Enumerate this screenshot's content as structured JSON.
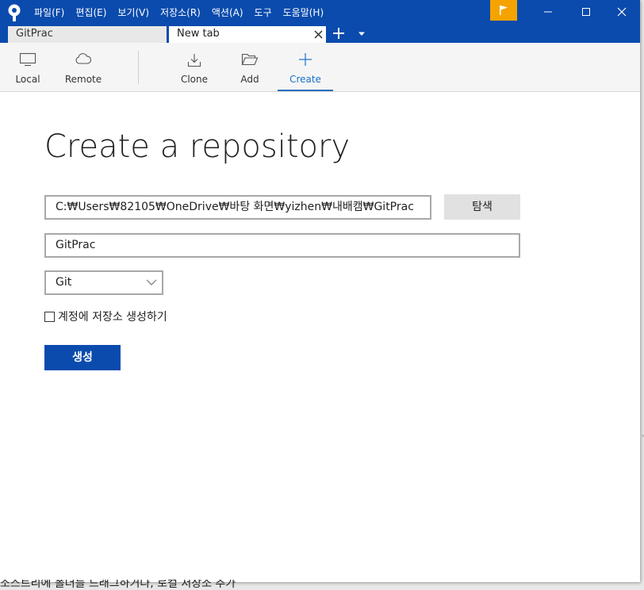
{
  "menu": [
    "파일(F)",
    "편집(E)",
    "보기(V)",
    "저장소(R)",
    "액션(A)",
    "도구",
    "도움말(H)"
  ],
  "tabs": {
    "inactive_label": "GitPrac",
    "active_label": "New tab"
  },
  "toolbar": {
    "local": "Local",
    "remote": "Remote",
    "clone": "Clone",
    "add": "Add",
    "create": "Create"
  },
  "form": {
    "heading": "Create a repository",
    "path_value": "C:₩Users₩82105₩OneDrive₩바탕 화면₩yizhen₩내배캠₩GitPrac",
    "browse_label": "탐색",
    "name_value": "GitPrac",
    "type_selected": "Git",
    "checkbox_label": "계정에 저장소 생성하기",
    "create_label": "생성"
  },
  "background_text": "소스트리에 폴더를 드래그하거나, 로컬 저장소 추가",
  "colors": {
    "titlebar": "#0a4bad",
    "flag": "#f5a300",
    "accent": "#1a73c9"
  },
  "icons": [
    "sourcetree-logo-icon",
    "flag-icon",
    "minimize-icon",
    "maximize-icon",
    "close-icon",
    "plus-icon",
    "chevron-down-icon",
    "monitor-icon",
    "cloud-icon",
    "download-icon",
    "folder-open-icon"
  ]
}
